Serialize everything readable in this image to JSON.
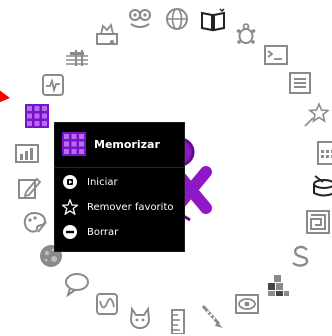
{
  "palette": {
    "title": "Memorizar",
    "items": [
      {
        "label": "Iniciar",
        "icon": "play-circle-icon"
      },
      {
        "label": "Remover favorito",
        "icon": "star-outline-icon"
      },
      {
        "label": "Borrar",
        "icon": "minus-circle-icon"
      }
    ]
  },
  "colors": {
    "accent": "#7a12c8",
    "icon_gray": "#8a8a8a",
    "pointer": "#ff0000",
    "palette_bg": "#000000"
  },
  "ring_icons": [
    "face-icon",
    "globe-icon",
    "book-icon",
    "turtle-icon",
    "terminal-icon",
    "list-icon",
    "shooting-star-icon",
    "calculator-icon",
    "drum-icon",
    "maze-icon",
    "snake-icon",
    "blocks-icon",
    "eye-icon",
    "clarinet-icon",
    "ruler-icon",
    "cat-icon",
    "wave-icon",
    "chat-bubble-icon",
    "moon-icon",
    "paint-palette-icon",
    "write-icon",
    "bar-chart-icon",
    "memorize-icon",
    "pulse-icon",
    "music-staff-icon",
    "toolbox-icon"
  ]
}
